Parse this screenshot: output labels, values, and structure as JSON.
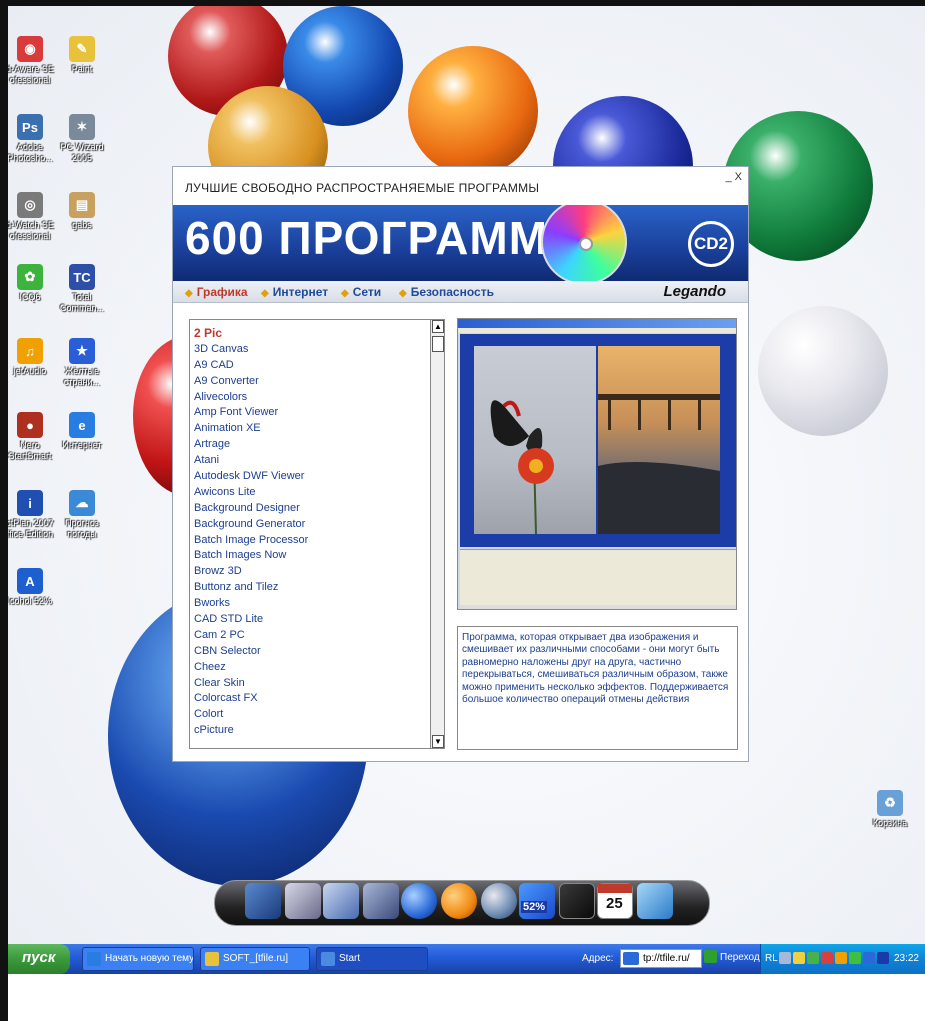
{
  "desktop": {
    "icons": [
      {
        "label": "d-Aware SE\nofessional",
        "color": "#d93b3b",
        "glyph": "◉"
      },
      {
        "label": "Paint",
        "color": "#e8c23a",
        "glyph": "✎"
      },
      {
        "label": "Adobe\nPhotosho...",
        "color": "#3a6fb0",
        "glyph": "Ps"
      },
      {
        "label": "PC Wizard\n2005",
        "color": "#e5e5e5",
        "glyph": "✶"
      },
      {
        "label": "d-Watch SE\nofessional",
        "color": "#7a7a7a",
        "glyph": "◎"
      },
      {
        "label": "gabs",
        "color": "#c8a060",
        "glyph": "▤"
      },
      {
        "label": "ICQ6",
        "color": "#3cb33c",
        "glyph": "✿"
      },
      {
        "label": "Total\nComman...",
        "color": "#2d4fa8",
        "glyph": "TC"
      },
      {
        "label": "jetAudio",
        "color": "#f0a000",
        "glyph": "♫"
      },
      {
        "label": "Жёлтые\nстрани...",
        "color": "#2a5ed6",
        "glyph": "★"
      },
      {
        "label": "Nero\nStartSmart",
        "color": "#b03020",
        "glyph": "●"
      },
      {
        "label": "Интернет",
        "color": "#2a7de0",
        "glyph": "e"
      },
      {
        "label": "ctPlan 2007\nffice Edition",
        "color": "#1f4fb0",
        "glyph": "i"
      },
      {
        "label": "Прогноз\nпогоды",
        "color": "#3a8ad8",
        "glyph": "☁"
      },
      {
        "label": "lcohol 52%",
        "color": "#1e5fd0",
        "glyph": "A"
      }
    ],
    "recycle_bin": "Корзина"
  },
  "window": {
    "tagline": "ЛУЧШИЕ  СВОБОДНО  РАСПРОСТРАНЯЕМЫЕ  ПРОГРАММЫ",
    "controls": "_ X",
    "title": "600 ПРОГРАММ",
    "cd_badge": "CD2",
    "brand": "Legando",
    "tabs": [
      {
        "label": "Графика",
        "active": true
      },
      {
        "label": "Интернет",
        "active": false
      },
      {
        "label": "Сети",
        "active": false
      },
      {
        "label": "Безопасность",
        "active": false
      }
    ],
    "programs": [
      "2 Pic",
      "3D Canvas",
      "A9 CAD",
      "A9 Converter",
      "Alivecolors",
      "Amp Font Viewer",
      "Animation XE",
      "Artrage",
      "Atani",
      "Autodesk DWF Viewer",
      "Awicons Lite",
      "Background Designer",
      "Background Generator",
      "Batch Image Processor",
      "Batch Images Now",
      "Browz 3D",
      "Buttonz and Tilez",
      "Bworks",
      "CAD STD Lite",
      "Cam 2 PC",
      "CBN Selector",
      "Cheez",
      "Clear Skin",
      "Colorcast FX",
      "Colort",
      "cPicture"
    ],
    "selected_index": 0,
    "description": "Программа, которая открывает два изображения и смешивает их различными способами - они могут быть равномерно наложены друг на друга, частично перекрываться, смешиваться различным образом, также можно применить несколько эффектов. Поддерживается большое количество операций отмены действия"
  },
  "dock": {
    "badge_percent": "52%",
    "calendar_day": "25"
  },
  "taskbar": {
    "start_label": "пуск",
    "tasks": [
      {
        "label": "Начать новую тему ...",
        "color": "#2a7de0"
      },
      {
        "label": "SOFT_[tfile.ru]",
        "color": "#e8c23a"
      },
      {
        "label": "Start",
        "color": "#4a8ae0"
      }
    ],
    "address_label": "Адрес:",
    "address_value": "tp://tfile.ru/",
    "go_label": "Переход",
    "tray_text": "RL",
    "clock": "23:22"
  },
  "colors": {
    "accent": "#1f4a9c",
    "active_tab": "#c0392b",
    "banner": "#1a3f9a",
    "taskbar": "#245edb"
  }
}
